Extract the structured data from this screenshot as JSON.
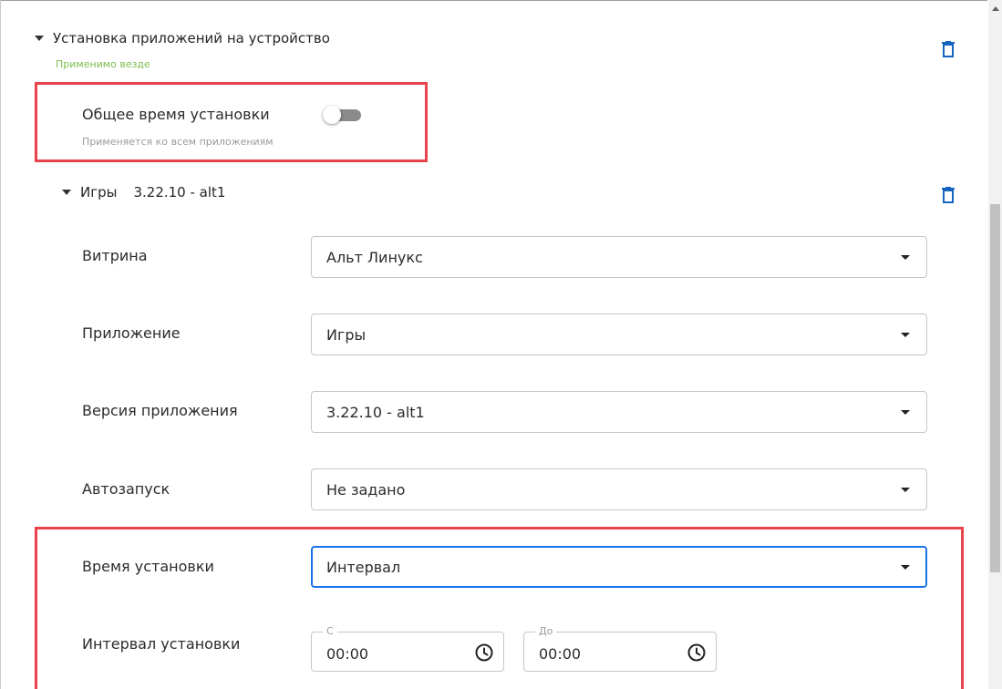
{
  "section": {
    "title": "Установка приложений на устройство",
    "applicability": "Применимо везде",
    "delete_icon": "trash-icon"
  },
  "common_install_time": {
    "label": "Общее время установки",
    "hint": "Применяется ко всем приложениям",
    "enabled": false
  },
  "app_group": {
    "name": "Игры",
    "version": "3.22.10 - alt1",
    "delete_icon": "trash-icon"
  },
  "fields": {
    "store": {
      "label": "Витрина",
      "value": "Альт Линукс"
    },
    "application": {
      "label": "Приложение",
      "value": "Игры"
    },
    "app_version": {
      "label": "Версия приложения",
      "value": "3.22.10 - alt1"
    },
    "autostart": {
      "label": "Автозапуск",
      "value": "Не задано"
    },
    "install_time": {
      "label": "Время установки",
      "value": "Интервал"
    },
    "install_interval": {
      "label": "Интервал установки",
      "from": {
        "legend": "С",
        "value": "00:00"
      },
      "to": {
        "legend": "До",
        "value": "00:00"
      }
    }
  },
  "colors": {
    "accent": "#1a73e8",
    "highlight": "#e8434a",
    "applicable_text": "#7cbd4e",
    "trash": "#1565c0"
  }
}
